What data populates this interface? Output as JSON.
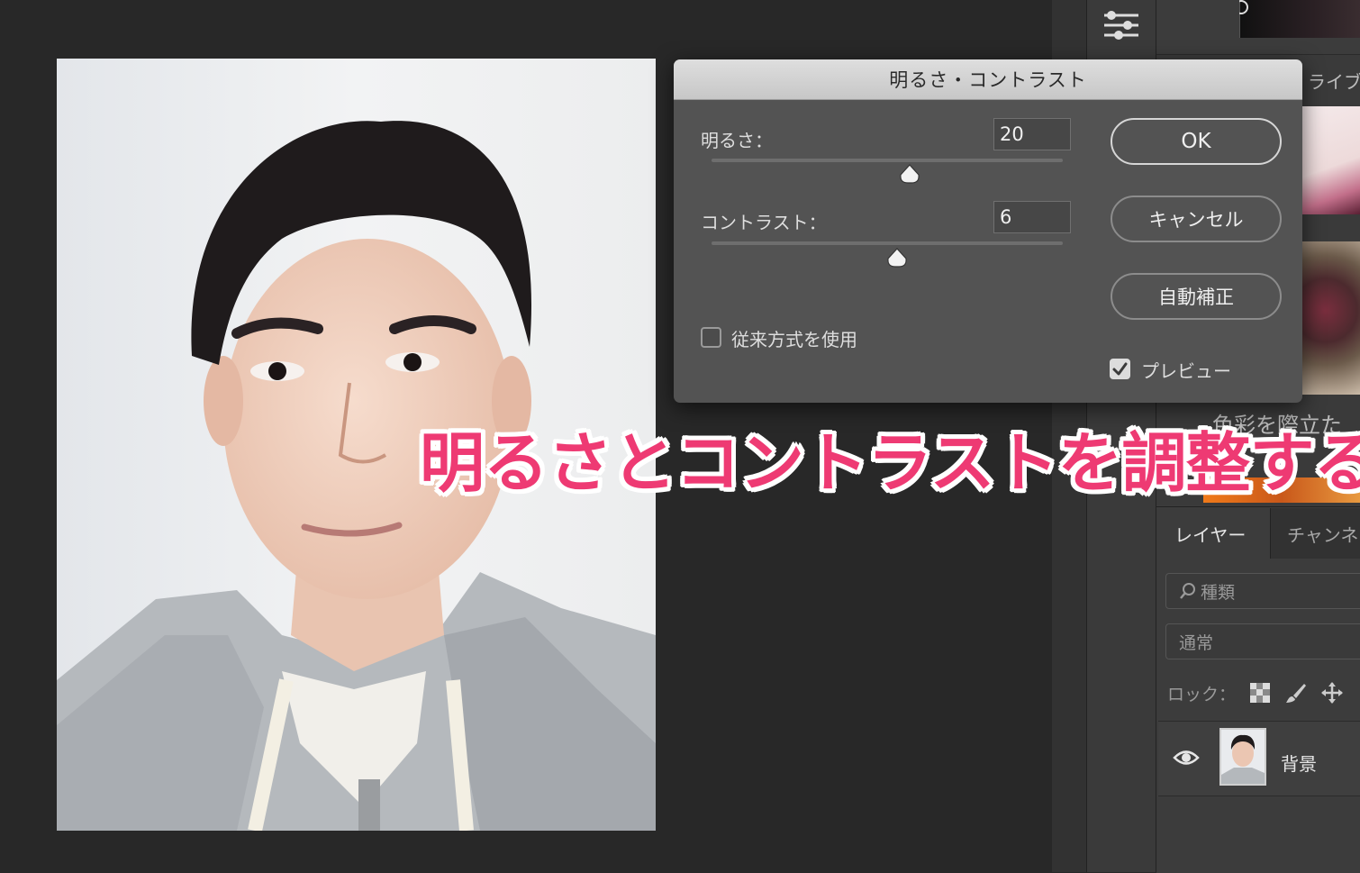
{
  "dialog": {
    "title": "明るさ・コントラスト",
    "brightness_label": "明るさ：",
    "brightness_value": "20",
    "contrast_label": "コントラスト：",
    "contrast_value": "6",
    "legacy_label": "従来方式を使用",
    "legacy_checked": false,
    "preview_label": "プレビュー",
    "preview_checked": true,
    "ok_label": "OK",
    "cancel_label": "キャンセル",
    "auto_label": "自動補正"
  },
  "overlay": {
    "caption": "明るさとコントラストを調整する",
    "caption_color": "#ee3a73"
  },
  "library": {
    "label": "ライブ",
    "caption": "色彩を際立た"
  },
  "layers_panel": {
    "tabs": [
      "レイヤー",
      "チャンネ"
    ],
    "filter_placeholder": "種類",
    "blend_mode": "通常",
    "lock_label": "ロック：",
    "layer_name": "背景"
  },
  "icons": [
    "adjustments-icon",
    "search-icon",
    "checkerboard-lock-icon",
    "brush-lock-icon",
    "move-lock-icon",
    "eye-icon",
    "checkmark-icon",
    "slider-thumb-icon"
  ]
}
